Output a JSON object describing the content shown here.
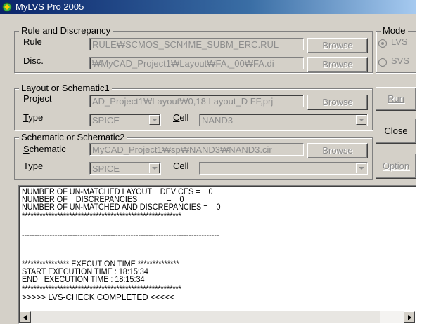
{
  "window": {
    "title": "MyLVS Pro 2005"
  },
  "rule_group": {
    "title": "Rule and Discrepancy",
    "rule_label": "Rule",
    "rule_value": "RULE₩SCMOS_SCN4ME_SUBM_ERC.RUL",
    "disc_label": "Disc.",
    "disc_value": "₩MyCAD_Project1₩Layout₩FA,_00₩FA.di",
    "browse_label": "Browse"
  },
  "mode_group": {
    "title": "Mode",
    "options": [
      "LVS",
      "SVS"
    ],
    "selected": "LVS"
  },
  "layout_group": {
    "title": "Layout or Schematic1",
    "project_label": "Project",
    "project_value": "AD_Project1₩Layout₩0,18 Layout_D FF,prj",
    "type_label": "Type",
    "type_value": "SPICE",
    "cell_label": "Cell",
    "cell_value": "NAND3",
    "browse_label": "Browse"
  },
  "schematic_group": {
    "title": "Schematic or Schematic2",
    "schematic_label": "Schematic",
    "schematic_value": "MyCAD_Project1₩sp₩NAND3₩NAND3.cir",
    "type_label": "Type",
    "type_value": "SPICE",
    "cell_label": "Cell",
    "cell_value": "",
    "browse_label": "Browse"
  },
  "actions": {
    "run": "Run",
    "close": "Close",
    "option": "Option"
  },
  "log": {
    "lines": [
      "NUMBER OF UN-MATCHED LAYOUT    DEVICES =    0",
      "NUMBER OF    DISCREPANCIES              =    0",
      "NUMBER OF UN-MATCHED AND DISCREPANCIES =    0",
      "******************************************************",
      "",
      "------------------------------------------------------------------------------",
      "",
      "",
      "**************** EXECUTION TIME **************",
      "START EXECUTION TIME : 18:15:34",
      "END   EXECUTION TIME : 18:15:34",
      "******************************************************",
      ">>>>> LVS-CHECK COMPLETED <<<<<"
    ]
  }
}
